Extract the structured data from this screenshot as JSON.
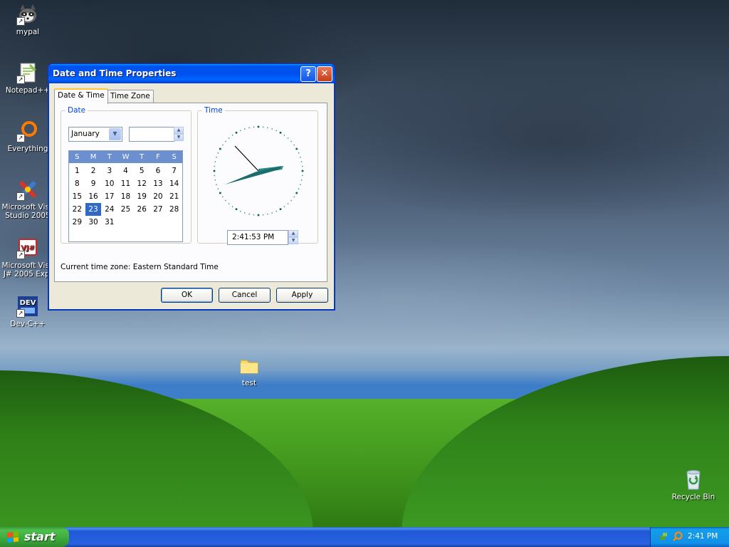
{
  "desktop": {
    "icons": [
      {
        "label": "mypal"
      },
      {
        "label": "Notepad++"
      },
      {
        "label": "Everything"
      },
      {
        "label": "Microsoft Visu Studio 2005"
      },
      {
        "label": "Microsoft Visu J# 2005 Exp."
      },
      {
        "label": "Dev-C++"
      },
      {
        "label": "test"
      },
      {
        "label": "Recycle Bin"
      }
    ]
  },
  "dialog": {
    "title": "Date and Time Properties",
    "help_glyph": "?",
    "close_glyph": "✕",
    "tabs": [
      {
        "label": "Date & Time",
        "active": true
      },
      {
        "label": "Time Zone",
        "active": false
      }
    ],
    "date": {
      "group_label": "Date",
      "month": "January",
      "year": "",
      "weekdays": [
        "S",
        "M",
        "T",
        "W",
        "T",
        "F",
        "S"
      ],
      "days": [
        "1",
        "2",
        "3",
        "4",
        "5",
        "6",
        "7",
        "8",
        "9",
        "10",
        "11",
        "12",
        "13",
        "14",
        "15",
        "16",
        "17",
        "18",
        "19",
        "20",
        "21",
        "22",
        "23",
        "24",
        "25",
        "26",
        "27",
        "28",
        "29",
        "30",
        "31"
      ],
      "selected_day": "23"
    },
    "time": {
      "group_label": "Time",
      "value": "2:41:53 PM"
    },
    "timezone_text": "Current time zone:  Eastern Standard Time",
    "buttons": {
      "ok": "OK",
      "cancel": "Cancel",
      "apply": "Apply"
    }
  },
  "taskbar": {
    "start_label": "start",
    "clock": "2:41 PM"
  },
  "colors": {
    "titlebar": "#0053ee",
    "calendar_header": "#6b8fcf",
    "selected_day": "#316ac5",
    "group_label": "#0046d5",
    "start_button": "#3ca83c"
  }
}
